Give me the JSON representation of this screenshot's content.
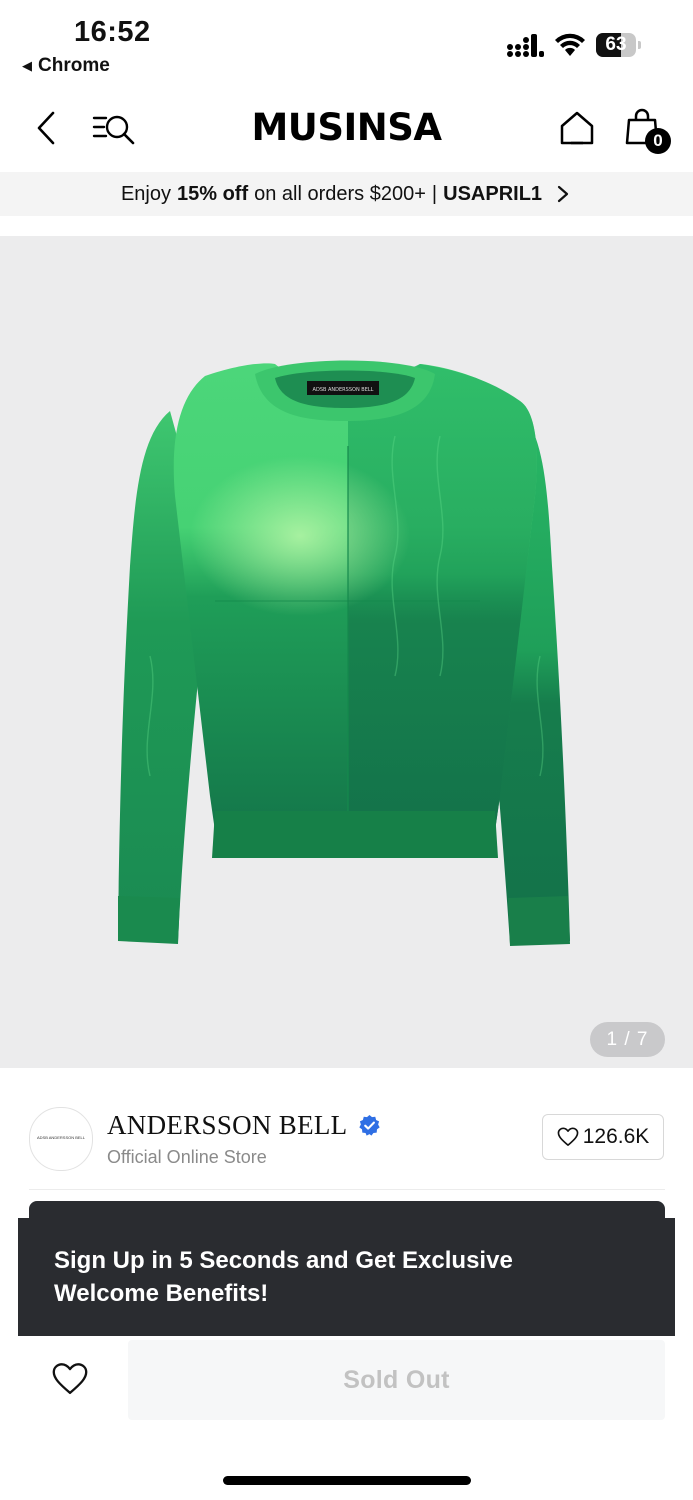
{
  "status_bar": {
    "time": "16:52",
    "back_app": "Chrome",
    "battery_level": "63",
    "battery_fraction": 0.63
  },
  "nav": {
    "logo": "MUSINSA",
    "cart_count": "0",
    "icons": [
      "back-chevron-icon",
      "search-menu-icon",
      "home-icon",
      "shopping-bag-icon"
    ]
  },
  "promo": {
    "prefix": "Enjoy",
    "highlight": "15% off",
    "middle": "on all orders $200+",
    "separator": "|",
    "code": "USAPRIL1"
  },
  "product": {
    "label_text": "ADSB ANDERSSON BELL",
    "image_counter": "1 / 7",
    "colors": {
      "light_green": "#4cd67a",
      "mid_green": "#22b25a",
      "dark_green": "#14774a"
    }
  },
  "store": {
    "avatar_text": "ADSB ANDERSSON BELL",
    "name": "ANDERSSON BELL",
    "subtitle": "Official Online Store",
    "likes": "126.6K"
  },
  "toast": {
    "message": "Sign Up in 5 Seconds and Get Exclusive Welcome Benefits!"
  },
  "cta": {
    "button_label": "Sold Out"
  },
  "colors": {
    "verified_blue": "#2f6fe4",
    "toast_bg": "#2a2c30"
  }
}
